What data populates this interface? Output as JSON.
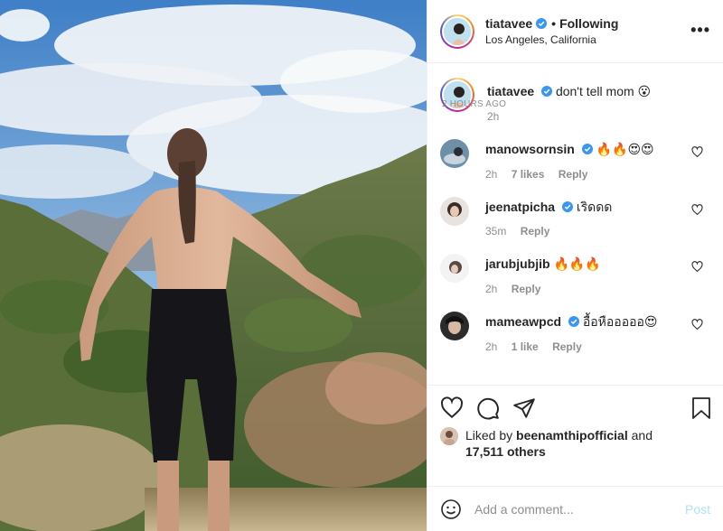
{
  "header": {
    "username": "tiatavee",
    "separator": "•",
    "following_label": "Following",
    "location": "Los Angeles, California",
    "more_icon": "more-horizontal-icon"
  },
  "caption": {
    "username": "tiatavee",
    "text": "don't tell mom",
    "emoji": "😮",
    "time": "2h"
  },
  "comments": [
    {
      "username": "manowsornsin",
      "verified": true,
      "text": "🔥🔥😍😍",
      "time": "2h",
      "likes": "7 likes",
      "reply": "Reply"
    },
    {
      "username": "jeenatpicha",
      "verified": true,
      "text": "เริดดด",
      "time": "35m",
      "likes": "",
      "reply": "Reply"
    },
    {
      "username": "jarubjubjib",
      "verified": false,
      "text": "🔥🔥🔥",
      "time": "2h",
      "likes": "",
      "reply": "Reply"
    },
    {
      "username": "mameawpcd",
      "verified": true,
      "text": "อื้อหือออออ😍",
      "time": "2h",
      "likes": "1 like",
      "reply": "Reply"
    }
  ],
  "actions": {
    "like_icon": "heart-icon",
    "comment_icon": "comment-icon",
    "share_icon": "send-icon",
    "save_icon": "bookmark-icon"
  },
  "likes": {
    "prefix": "Liked by",
    "user": "beenamthipofficial",
    "middle": "and",
    "count": "17,511 others"
  },
  "time_ago": "2 HOURS AGO",
  "add_comment": {
    "placeholder": "Add a comment...",
    "post_label": "Post",
    "emoji_icon": "smile-icon"
  },
  "colors": {
    "verified_blue": "#3897f0",
    "post_disabled": "#b2dffc",
    "meta_gray": "#8e8e8e"
  }
}
